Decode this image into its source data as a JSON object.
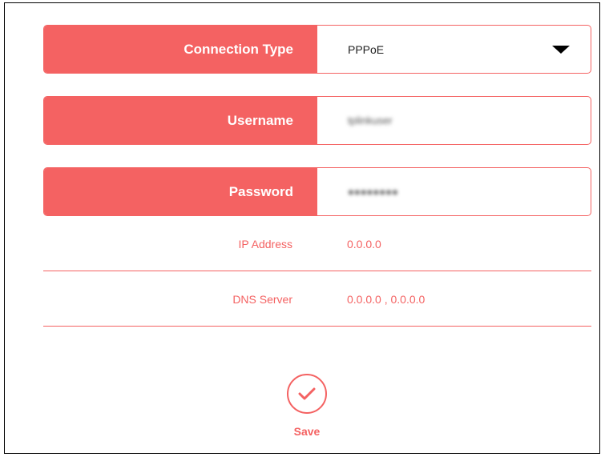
{
  "form": {
    "connection_type": {
      "label": "Connection Type",
      "value": "PPPoE",
      "icon": "caret-down-icon"
    },
    "username": {
      "label": "Username",
      "value": "tplinkuser"
    },
    "password": {
      "label": "Password",
      "value": "●●●●●●●●"
    }
  },
  "info": {
    "ip_address": {
      "label": "IP Address",
      "value": "0.0.0.0"
    },
    "dns_server": {
      "label": "DNS Server",
      "value": "0.0.0.0 , 0.0.0.0"
    }
  },
  "actions": {
    "save_label": "Save",
    "save_icon": "checkmark-circle-icon"
  },
  "colors": {
    "accent": "#f46262",
    "text_dark": "#222222",
    "background": "#ffffff"
  }
}
